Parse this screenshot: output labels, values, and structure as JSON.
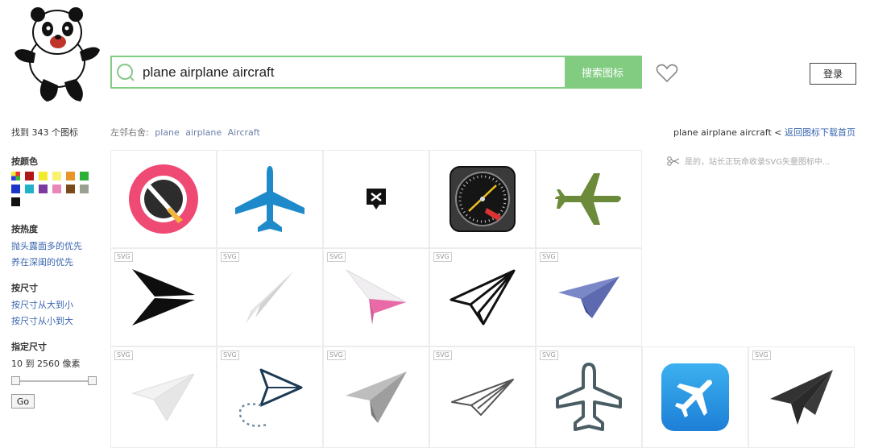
{
  "search": {
    "value": "plane airplane aircraft",
    "button_label": "搜索图标"
  },
  "header": {
    "login_label": "登录"
  },
  "related": {
    "label": "左邻右舍:",
    "links": [
      "plane",
      "airplane",
      "Aircraft"
    ]
  },
  "crumb": {
    "query": "plane airplane aircraft",
    "sep": " < ",
    "back": "返回图标下载首页"
  },
  "note": {
    "text": "是的，站长正玩命收录SVG矢量图标中..."
  },
  "sidebar": {
    "found": "找到 343 个图标",
    "color_title": "按颜色",
    "colors": [
      "multi",
      "#b01818",
      "#f2ea2c",
      "#f7f270",
      "#e8952a",
      "#2bb13a",
      "#1b35c8",
      "#20b3c8",
      "#7a3aa0",
      "#e887b8",
      "#7a4a1a",
      "#9aa090",
      "#111111"
    ],
    "hot_title": "按热度",
    "hot_links": [
      "抛头露面多的优先",
      "养在深闺的优先"
    ],
    "size_title": "按尺寸",
    "size_links": [
      "按尺寸从大到小",
      "按尺寸从小到大"
    ],
    "range_title": "指定尺寸",
    "range_text": "10 到 2560 像素",
    "slider": {
      "min": 10,
      "max": 2560,
      "low": 10,
      "high": 2560
    },
    "go_label": "Go"
  },
  "icons": [
    {
      "name": "compass-app-icon",
      "svg": false
    },
    {
      "name": "blue-airplane-icon",
      "svg": false
    },
    {
      "name": "airport-badge-icon",
      "svg": false
    },
    {
      "name": "flight-gauge-icon",
      "svg": false
    },
    {
      "name": "olive-airplane-icon",
      "svg": false
    },
    {
      "name": "black-paper-plane-icon",
      "svg": true
    },
    {
      "name": "light-gray-paper-plane-icon",
      "svg": true
    },
    {
      "name": "pink-paper-plane-icon",
      "svg": true
    },
    {
      "name": "outline-paper-plane-icon",
      "svg": true
    },
    {
      "name": "blue-paper-plane-icon",
      "svg": true
    },
    {
      "name": "white-paper-plane-icon",
      "svg": true
    },
    {
      "name": "dotted-trail-paper-plane-icon",
      "svg": true
    },
    {
      "name": "gray-paper-plane-icon",
      "svg": true
    },
    {
      "name": "thin-outline-paper-plane-icon",
      "svg": true
    },
    {
      "name": "airplane-outline-icon",
      "svg": true
    },
    {
      "name": "blue-app-airplane-icon",
      "svg": false
    },
    {
      "name": "dark-paper-plane-icon",
      "svg": true
    }
  ],
  "svg_tag": "SVG"
}
